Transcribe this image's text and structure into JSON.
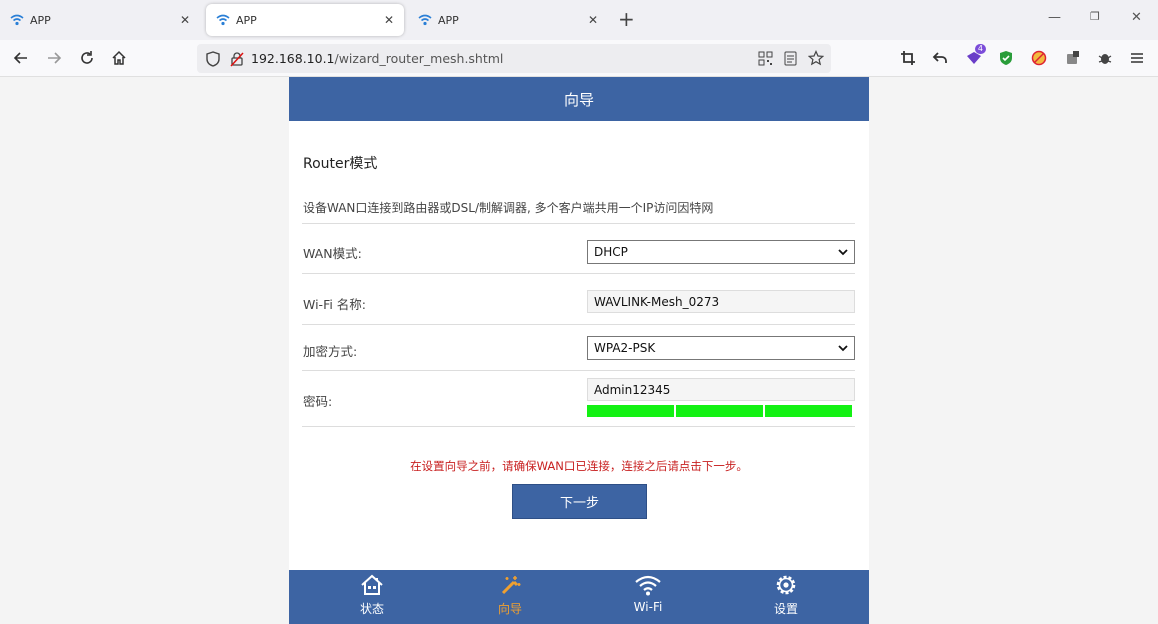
{
  "browser": {
    "tabs": [
      {
        "title": "APP",
        "active": false
      },
      {
        "title": "APP",
        "active": true
      },
      {
        "title": "APP",
        "active": false
      }
    ],
    "url_host": "192.168.10.1",
    "url_path": "/wizard_router_mesh.shtml",
    "extension_badge": "4"
  },
  "page": {
    "header_title": "向导",
    "section_title": "Router模式",
    "description": "设备WAN口连接到路由器或DSL/制解调器, 多个客户端共用一个IP访问因特网",
    "form": {
      "wan_mode_label": "WAN模式:",
      "wan_mode_value": "DHCP",
      "wifi_name_label": "Wi-Fi 名称:",
      "wifi_name_value": "WAVLINK-Mesh_0273",
      "encryption_label": "加密方式:",
      "encryption_value": "WPA2-PSK",
      "password_label": "密码:",
      "password_value": "Admin12345",
      "password_strength_segments": 3,
      "password_strength_filled": 3
    },
    "warning": "在设置向导之前，请确保WAN口已连接，连接之后请点击下一步。",
    "next_button": "下一步"
  },
  "bottom_nav": [
    {
      "label": "状态",
      "icon": "home-icon",
      "active": false
    },
    {
      "label": "向导",
      "icon": "wizard-wand-icon",
      "active": true
    },
    {
      "label": "Wi-Fi",
      "icon": "wifi-icon",
      "active": false
    },
    {
      "label": "设置",
      "icon": "gear-icon",
      "active": false
    }
  ],
  "colors": {
    "brand_blue": "#3d64a3",
    "active_orange": "#f0a030",
    "warning_red": "#c82121",
    "strength_green": "#13f113"
  }
}
